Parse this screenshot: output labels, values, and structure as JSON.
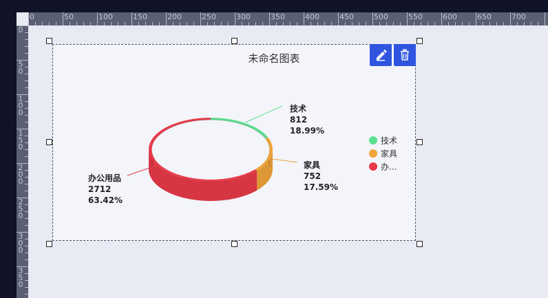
{
  "ruler": {
    "h_labels": [
      "0",
      "50",
      "100",
      "150",
      "200",
      "250",
      "300",
      "350",
      "400",
      "450",
      "500",
      "550",
      "600",
      "650",
      "700"
    ],
    "v_labels": [
      "0",
      "50",
      "100",
      "150",
      "200",
      "250",
      "300",
      "350"
    ]
  },
  "chart": {
    "title": "未命名图表",
    "edit_tooltip": "edit",
    "delete_tooltip": "delete"
  },
  "chart_data": {
    "type": "pie",
    "style": "3d-ring",
    "title": "未命名图表",
    "legend": [
      "技术",
      "家具",
      "办..."
    ],
    "legend_position": "right",
    "series": [
      {
        "name": "技术",
        "value": 812,
        "percent": "18.99%",
        "color": "#5ce08f"
      },
      {
        "name": "家具",
        "value": 752,
        "percent": "17.59%",
        "color": "#f0a43a"
      },
      {
        "name": "办公用品",
        "value": 2712,
        "percent": "63.42%",
        "color": "#e93a48"
      }
    ]
  }
}
